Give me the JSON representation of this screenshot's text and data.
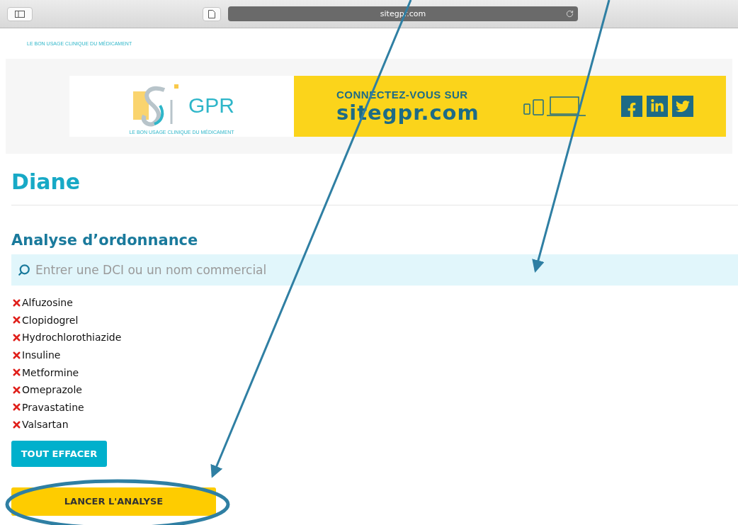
{
  "browser": {
    "url": "sitegpr.com"
  },
  "header": {
    "tagline": "LE BON USAGE CLINIQUE DU MÉDICAMENT"
  },
  "banner": {
    "logo_text": "GPR",
    "logo_tagline": "LE BON USAGE CLINIQUE DU MÉDICAMENT",
    "connect_text": "CONNECTEZ-VOUS SUR",
    "site": "sitegpr.com"
  },
  "title": "Diane",
  "section_title": "Analyse d’ordonnance",
  "search": {
    "placeholder": "Entrer une DCI ou un nom commercial"
  },
  "drugs": [
    {
      "name": "Alfuzosine"
    },
    {
      "name": "Clopidogrel"
    },
    {
      "name": "Hydrochlorothiazide"
    },
    {
      "name": "Insuline"
    },
    {
      "name": "Metformine"
    },
    {
      "name": "Omeprazole"
    },
    {
      "name": "Pravastatine"
    },
    {
      "name": "Valsartan"
    }
  ],
  "buttons": {
    "clear": "TOUT EFFACER",
    "run": "LANCER L'ANALYSE"
  }
}
